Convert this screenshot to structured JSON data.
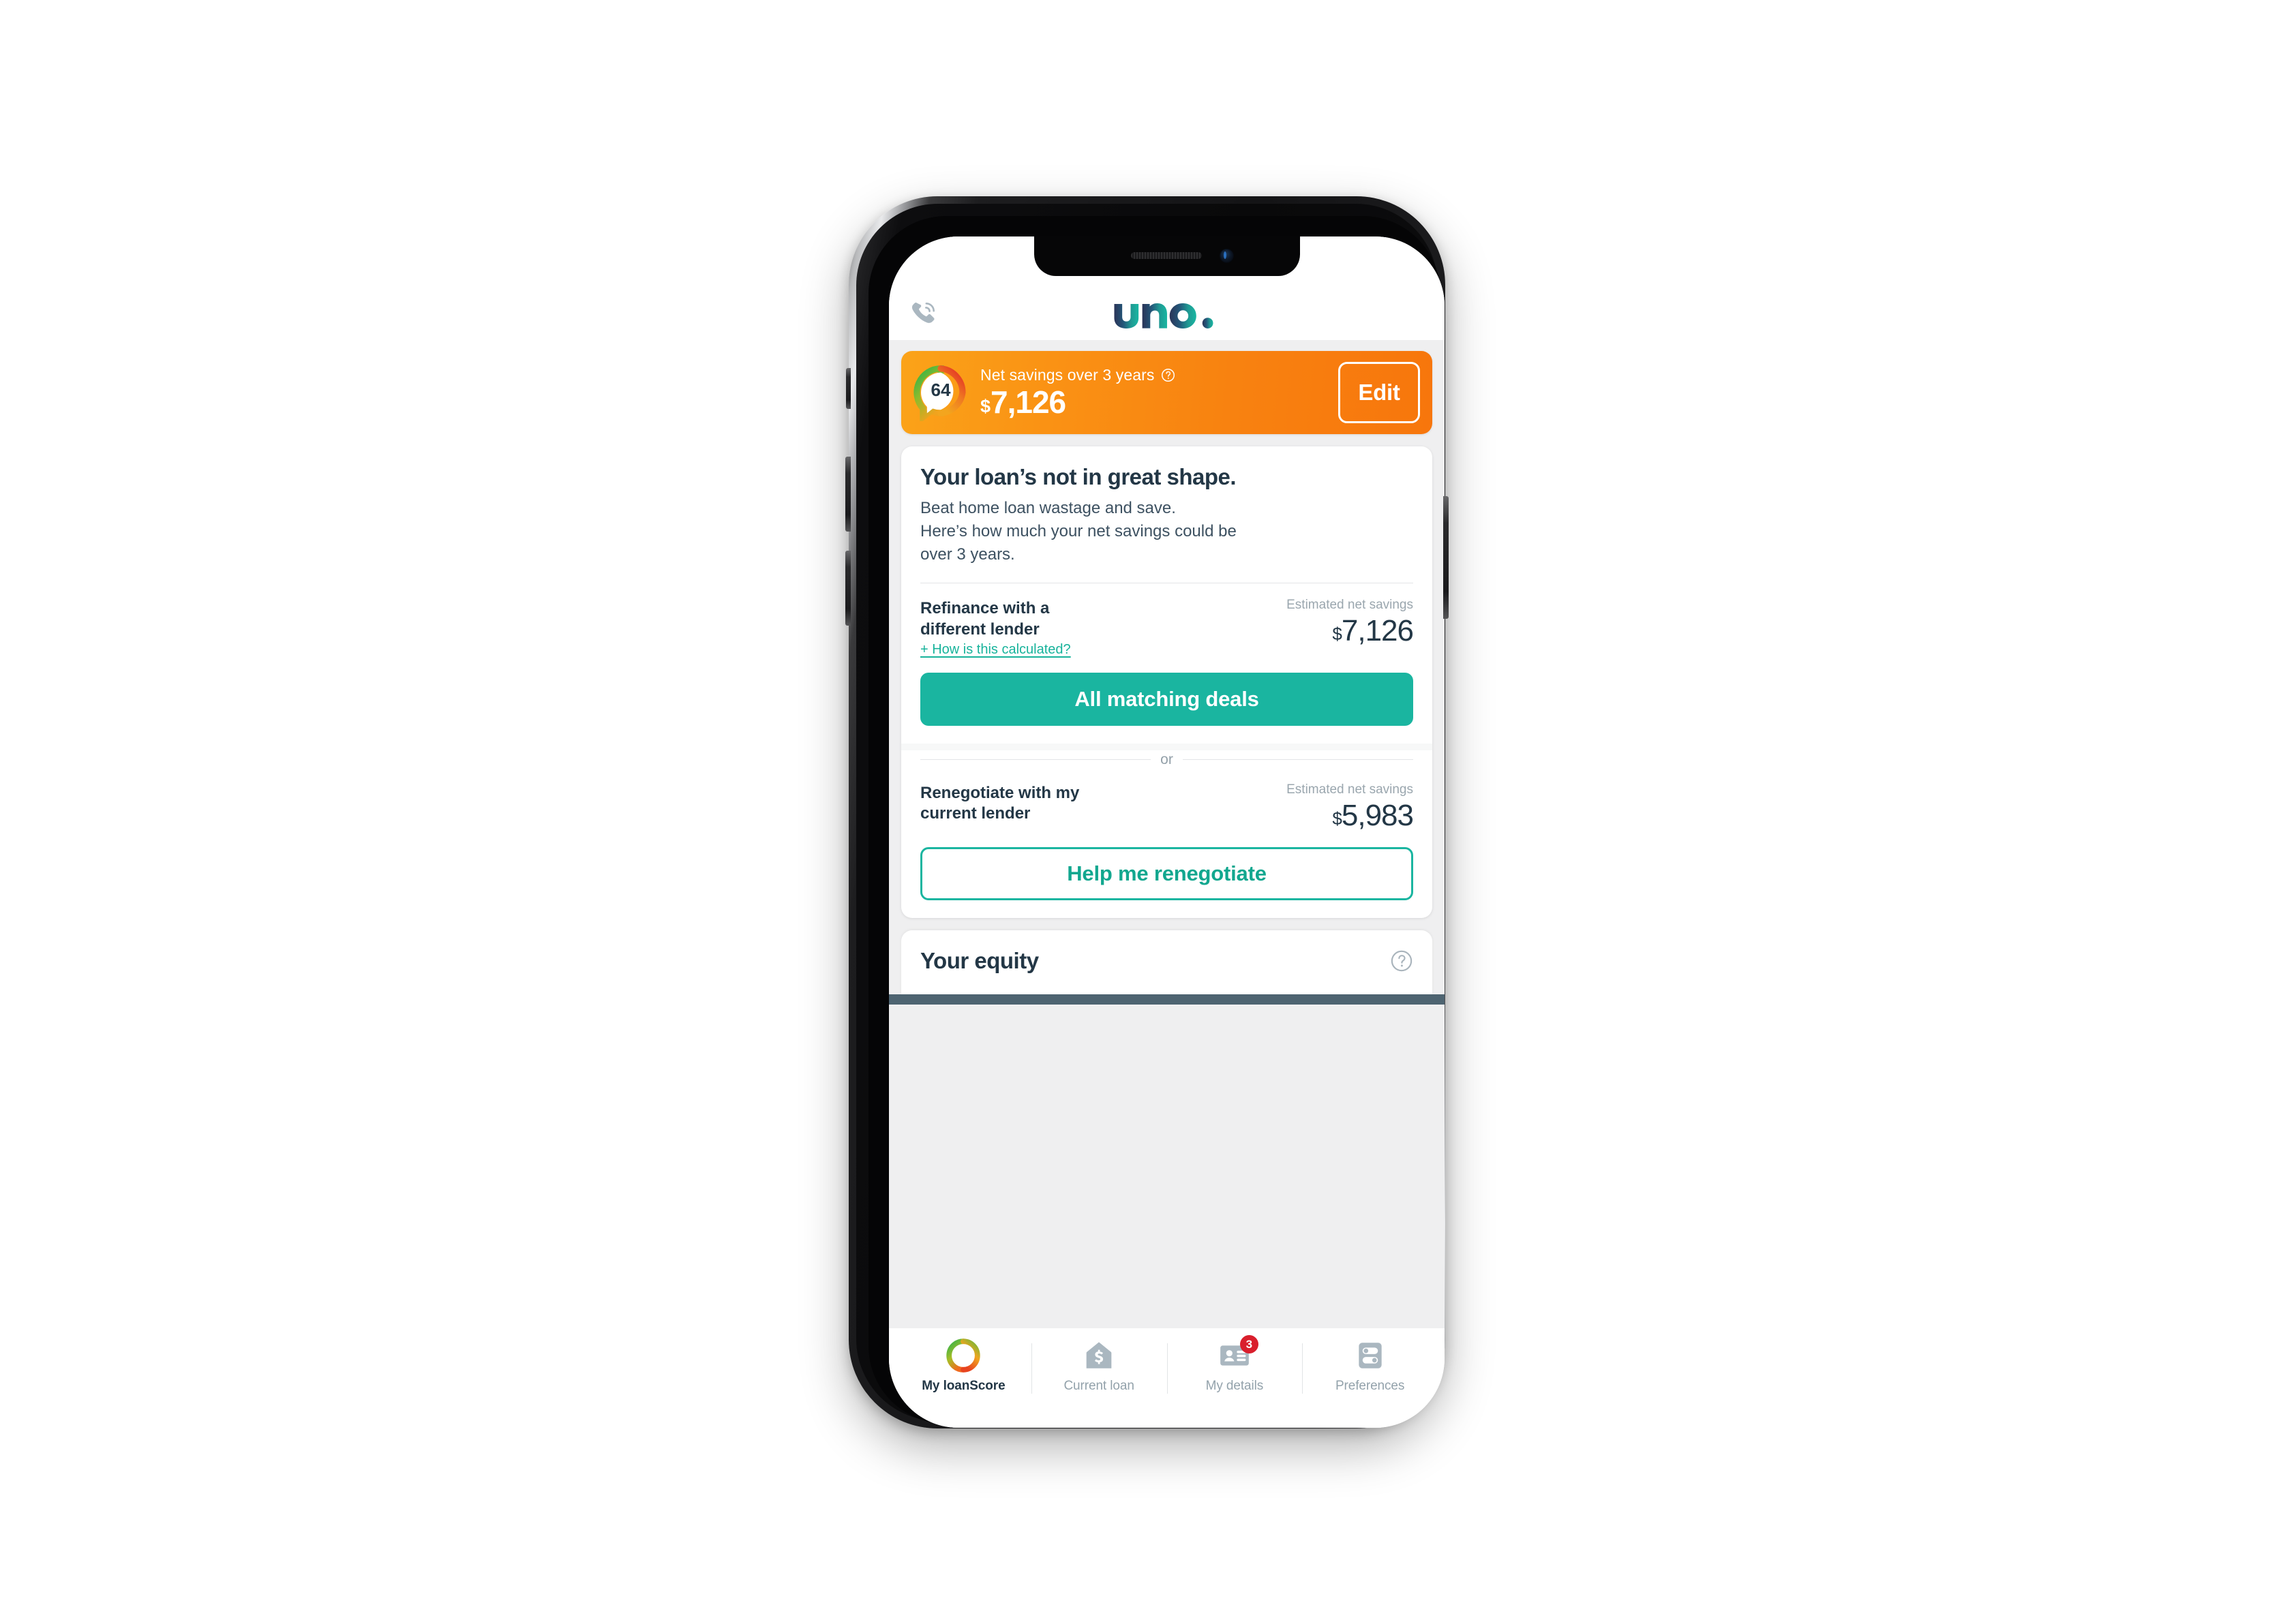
{
  "app": {
    "header": {
      "call_icon": "phone-call-icon",
      "logo_text": "uno."
    },
    "savings_banner": {
      "score": "64",
      "label": "Net savings over 3 years",
      "help_icon": "question-mark-icon",
      "currency": "$",
      "amount": "7,126",
      "edit_label": "Edit"
    },
    "loan_card": {
      "title": "Your loan’s not in great shape.",
      "subtitle_line1": "Beat home loan wastage and save.",
      "subtitle_line2": "Here’s how much your net savings could be",
      "subtitle_line3": "over 3 years.",
      "refinance": {
        "name_line1": "Refinance with a",
        "name_line2": "different lender",
        "calc_link": "+ How is this calculated?",
        "est_label": "Estimated net savings",
        "currency": "$",
        "amount": "7,126",
        "cta": "All matching deals"
      },
      "separator": "or",
      "renegotiate": {
        "name_line1": "Renegotiate with my",
        "name_line2": "current lender",
        "est_label": "Estimated net savings",
        "currency": "$",
        "amount": "5,983",
        "cta": "Help me renegotiate"
      }
    },
    "equity_card": {
      "title": "Your equity",
      "help_icon": "question-mark-icon"
    },
    "tabbar": [
      {
        "label": "My loanScore",
        "icon": "loanscore-ring-icon",
        "active": true,
        "badge": ""
      },
      {
        "label": "Current loan",
        "icon": "house-dollar-icon",
        "active": false,
        "badge": ""
      },
      {
        "label": "My details",
        "icon": "id-card-icon",
        "active": false,
        "badge": "3"
      },
      {
        "label": "Preferences",
        "icon": "toggles-icon",
        "active": false,
        "badge": ""
      }
    ],
    "colors": {
      "teal": "#1ab5a0",
      "navy": "#233746",
      "orange_start": "#fba319",
      "orange_end": "#f7760c",
      "badge_red": "#d91f2d",
      "slate": "#4e6471",
      "muted": "#93a2ab"
    }
  }
}
